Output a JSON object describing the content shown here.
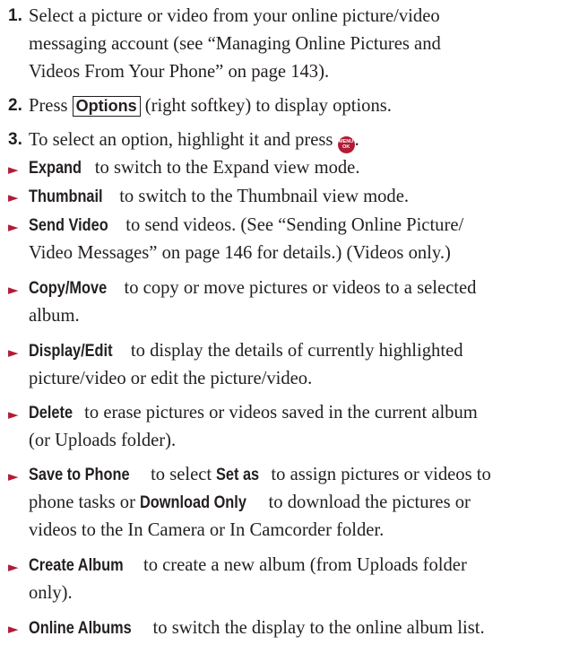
{
  "steps": [
    {
      "number": "1.",
      "lines": [
        "Select a picture or video from your online picture/video",
        "messaging account (see “Managing Online Pictures and",
        "Videos From Your Phone” on page 143)."
      ]
    },
    {
      "number": "2.",
      "pre": "Press ",
      "softkey": "Options",
      "post": " (right softkey) to display options."
    },
    {
      "number": "3.",
      "pre": "To select an option, highlight it and press ",
      "key_top": "MENU",
      "key_bottom": "OK",
      "post": "."
    }
  ],
  "options": [
    {
      "name": "Expand",
      "lines": [
        " to switch to the Expand view mode."
      ]
    },
    {
      "name": "Thumbnail",
      "lines": [
        " to switch to the Thumbnail view mode."
      ]
    },
    {
      "name": "Send Video",
      "lines": [
        " to send videos. (See “Sending Online Picture/",
        "Video Messages” on page 146 for details.) (Videos only.)"
      ]
    },
    {
      "name": "Copy/Move",
      "lines": [
        " to copy or move pictures or videos to a selected",
        "album."
      ]
    },
    {
      "name": "Display/Edit",
      "lines": [
        " to display the details of currently highlighted",
        "picture/video or edit the picture/video."
      ]
    },
    {
      "name": "Delete",
      "lines": [
        " to erase pictures or videos saved in the current album",
        "(or Uploads folder)."
      ]
    },
    {
      "name": "Save to Phone",
      "line1_pre": " to select ",
      "line1_bold": "Set as",
      "line1_post": " to assign pictures or videos to",
      "line2_pre": "phone tasks or ",
      "line2_bold": "Download Only",
      "line2_post": " to download the pictures or",
      "line3": "videos to the In Camera or In Camcorder folder."
    },
    {
      "name": "Create Album",
      "lines": [
        " to create a new album (from Uploads folder",
        "only)."
      ]
    },
    {
      "name": "Online Albums",
      "lines": [
        " to switch the display to the online album list."
      ]
    }
  ],
  "bullet_glyph": "►",
  "colors": {
    "text": "#231f20",
    "bullet": "#b31b34",
    "menu_key": "#b31b34"
  }
}
